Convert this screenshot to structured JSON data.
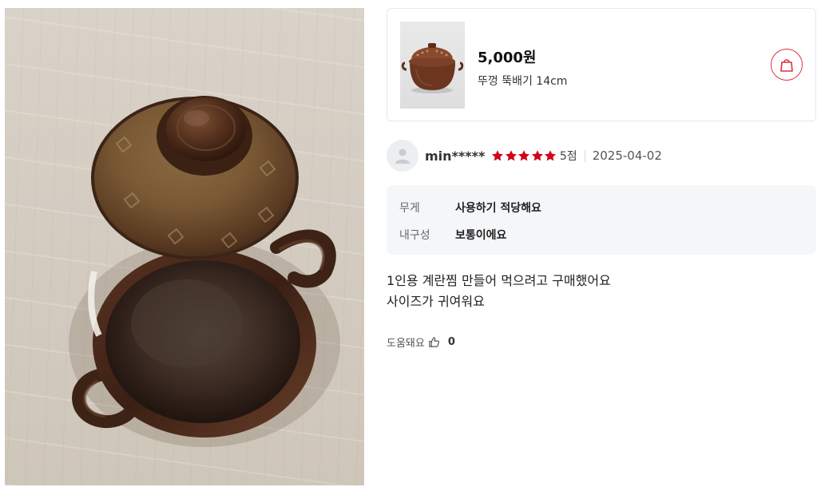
{
  "product": {
    "price": "5,000원",
    "name": "뚜껑 뚝배기 14cm"
  },
  "review": {
    "reviewer": "min*****",
    "rating": 5,
    "score_label": "5점",
    "date": "2025-04-02",
    "attributes": [
      {
        "label": "무게",
        "value": "사용하기 적당해요"
      },
      {
        "label": "내구성",
        "value": "보통이에요"
      }
    ],
    "text_lines": [
      "1인용 계란찜 만들어 먹으려고 구매했어요",
      "사이즈가 귀여워요"
    ],
    "helpful_label": "도움돼요",
    "helpful_count": "0"
  },
  "colors": {
    "accent": "#e03040",
    "star": "#d0021b",
    "attr_bg": "#f5f6f8"
  },
  "icons": {
    "cart": "shopping-bag-icon",
    "avatar": "user-icon",
    "star": "star-icon",
    "helpful": "thumbs-up-icon"
  }
}
